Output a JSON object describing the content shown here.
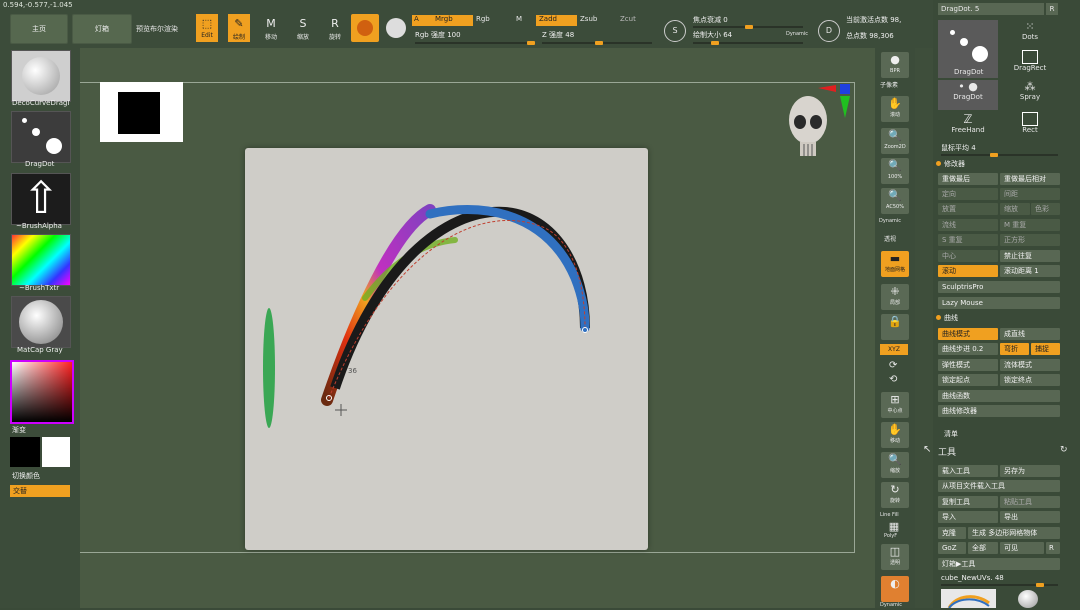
{
  "coords": "0.594,-0.577,-1.045",
  "topbar": {
    "home": "主页",
    "lightbox": "灯箱",
    "bpr": "预览布尔渲染",
    "edit": "Edit",
    "draw": "绘制",
    "move": "移动",
    "scale": "缩放",
    "rotate": "旋转",
    "a_label": "A",
    "mrgb": "Mrgb",
    "rgb": "Rgb",
    "m": "M",
    "zadd": "Zadd",
    "zsub": "Zsub",
    "zcut": "Zcut",
    "rgb_intensity": "Rgb 强度 100",
    "z_intensity": "Z 强度 48",
    "focal_shift": "焦点衰减 0",
    "draw_size": "绘制大小 64",
    "dynamic": "Dynamic",
    "active_points": "当前激活点数 98,",
    "total_points": "总点数 98,306",
    "s": "S",
    "d": "D"
  },
  "left": {
    "brush": "DecoCurveDragI",
    "stroke": "DragDot",
    "alpha": "~BrushAlpha",
    "texture": "~BrushTxtr",
    "material": "MatCap Gray",
    "gradient": "渐变",
    "switch_color": "切换颜色",
    "alternate": "交替"
  },
  "right": {
    "bpr": "BPR",
    "subpixel": "子像素",
    "scroll": "滚动",
    "zoom2d": "Zoom2D",
    "pct100": "100%",
    "ac50": "AC50%",
    "dynamic": "Dynamic",
    "persp": "透视",
    "floor": "地面网格",
    "local": "局部",
    "xyz": "XYZ",
    "frame": "中心点",
    "move": "移动",
    "zoom": "缩放",
    "rotate": "旋转",
    "linefill": "Line Fill",
    "polyf": "PolyF",
    "transp": "透明",
    "dynamic2": "Dynamic"
  },
  "panel": {
    "title_stroke": "DragDot. 5",
    "r": "R",
    "strokes": [
      "DragDot",
      "Dots",
      "DragRect",
      "DragDot",
      "Spray",
      "FreeHand",
      "Rect"
    ],
    "mouse_avg": "鼠标平均 4",
    "modifiers": "修改器",
    "repeat_last": "重做最后",
    "repeat_last_rel": "重做最后相对",
    "orient": "定向",
    "spacing": "间距",
    "placement": "放置",
    "scale": "缩放",
    "color": "色彩",
    "flow": "流线",
    "m_repeat": "M 重复",
    "s_repeat": "S 重复",
    "square": "正方形",
    "center": "中心",
    "no_repeat": "禁止往复",
    "roll": "滚动",
    "roll_dist": "滚动距离 1",
    "sculptris": "SculptrisPro",
    "lazymouse": "Lazy Mouse",
    "curve": "曲线",
    "curve_mode": "曲线模式",
    "as_line": "成直线",
    "curve_step": "曲线步进 0.2",
    "bend": "弯折",
    "snap": "捕捉",
    "elastic": "弹性模式",
    "liquid": "流体模式",
    "lock_start": "锁定起点",
    "lock_end": "锁定终点",
    "curve_func": "曲线函数",
    "curve_mod": "曲线修改器",
    "clear": "清单",
    "tool": "工具",
    "load_tool": "载入工具",
    "save_as": "另存为",
    "load_from_project": "从项目文件载入工具",
    "copy_tool": "复制工具",
    "paste_tool": "粘贴工具",
    "import": "导入",
    "export": "导出",
    "clone": "克隆",
    "make_polymesh": "生成 多边形网格物体",
    "goz": "GoZ",
    "all": "全部",
    "visible": "可见",
    "lightbox_tool": "灯箱▶工具",
    "current_tool": "cube_NewUVs. 48"
  },
  "canvas": {
    "label_36": "36"
  }
}
